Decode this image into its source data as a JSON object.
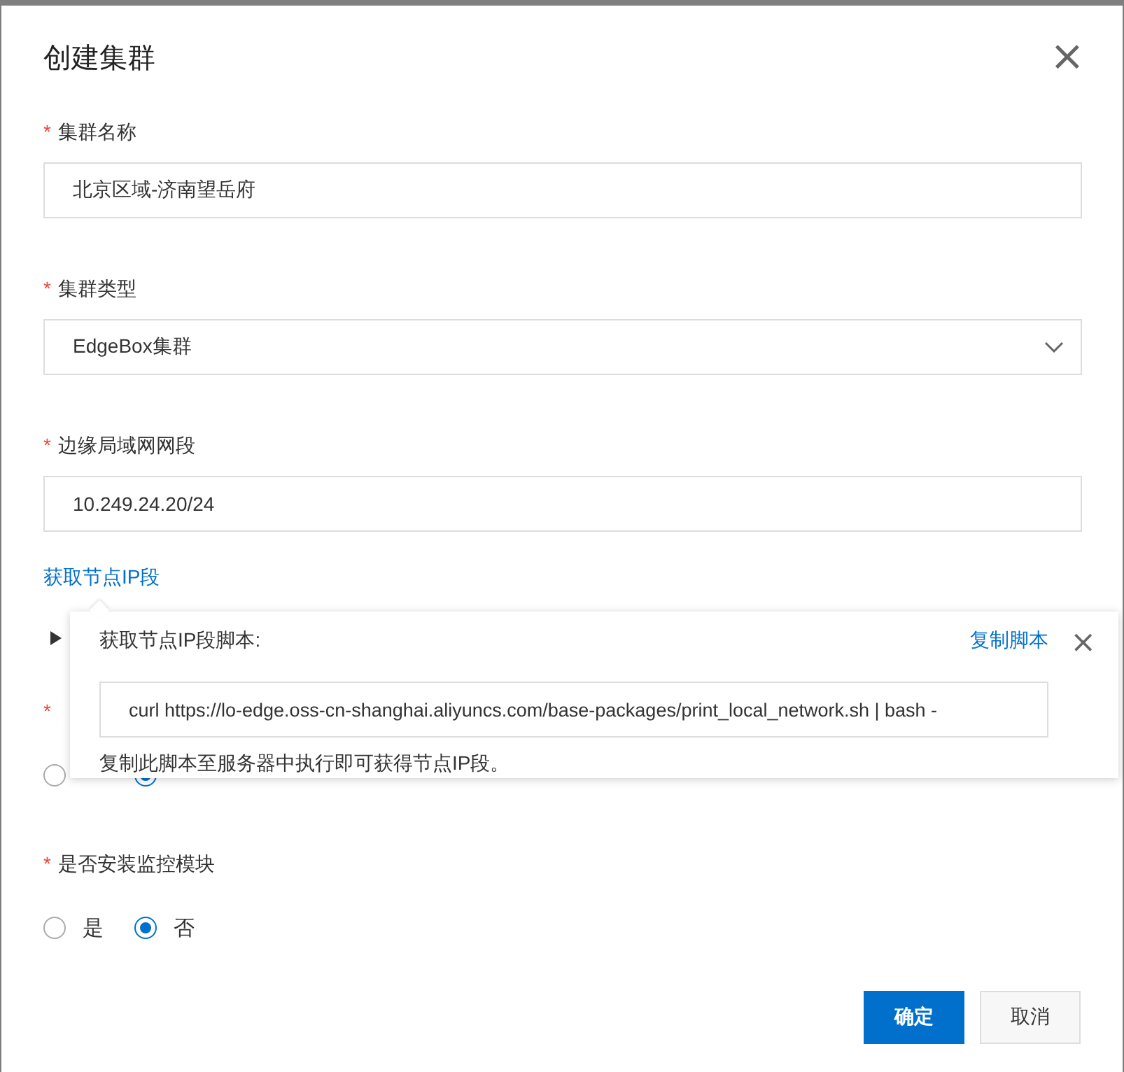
{
  "dialog": {
    "title": "创建集群",
    "close": "×"
  },
  "fields": [
    {
      "kind": "input",
      "required_mark": "*",
      "label": "集群名称",
      "value": "北京区域-济南望岳府"
    },
    {
      "kind": "select",
      "required_mark": "*",
      "label": "集群类型",
      "value": "EdgeBox集群"
    },
    {
      "kind": "input",
      "required_mark": "*",
      "label": "边缘局域网网段",
      "value": "10.249.24.20/24"
    },
    {
      "kind": "link",
      "label": "获取节点IP段"
    },
    {
      "kind": "collapse",
      "expanded": false
    },
    {
      "kind": "radio",
      "required_mark": "*",
      "options": [
        {
          "selected": false
        },
        {
          "selected": true
        }
      ]
    },
    {
      "kind": "radio",
      "required_mark": "*",
      "label": "是否安装监控模块",
      "options": [
        {
          "label": "是",
          "selected": false
        },
        {
          "label": "否",
          "selected": true
        }
      ]
    }
  ],
  "popover": {
    "title": "获取节点IP段脚本:",
    "copy_link": "复制脚本",
    "close": "×",
    "script": "curl https://lo-edge.oss-cn-shanghai.aliyuncs.com/base-packages/print_local_network.sh | bash -",
    "hint": "复制此脚本至服务器中执行即可获得节点IP段。"
  },
  "buttons": [
    {
      "label": "确定",
      "kind": "primary"
    },
    {
      "label": "取消",
      "kind": "secondary"
    }
  ]
}
